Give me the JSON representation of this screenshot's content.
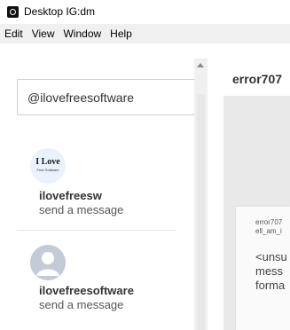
{
  "window": {
    "title": "Desktop IG:dm"
  },
  "menu": [
    "Edit",
    "View",
    "Window",
    "Help"
  ],
  "search": {
    "value": "@ilovefreesoftware"
  },
  "contacts": [
    {
      "name": "ilovefreesw",
      "subtitle": "send a message",
      "avatar_logo": "I Love",
      "avatar_logo_sub": "Free Software"
    },
    {
      "name": "ilovefreesoftware",
      "subtitle": "send a message"
    }
  ],
  "chat": {
    "title": "error707",
    "message_meta_line1": "error707",
    "message_meta_line2": "ell_am_i",
    "message_lines": [
      "<unsu",
      "mess",
      "forma"
    ]
  }
}
